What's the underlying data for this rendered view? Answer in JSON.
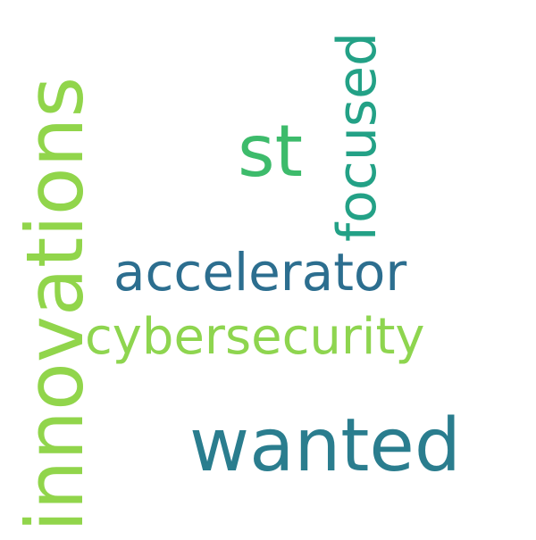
{
  "words": [
    {
      "text": "innovations",
      "color": "#91d54b",
      "orientation": "vertical"
    },
    {
      "text": "st",
      "color": "#3dbb6b",
      "orientation": "horizontal"
    },
    {
      "text": "focused",
      "color": "#23a186",
      "orientation": "vertical"
    },
    {
      "text": "accelerator",
      "color": "#2c6e8f",
      "orientation": "horizontal"
    },
    {
      "text": "cybersecurity",
      "color": "#8ed54f",
      "orientation": "horizontal"
    },
    {
      "text": "wanted",
      "color": "#2a7d8e",
      "orientation": "horizontal"
    }
  ]
}
